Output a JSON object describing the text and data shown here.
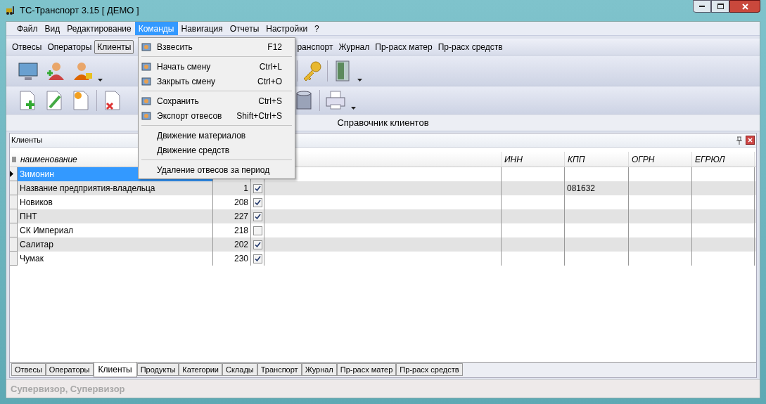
{
  "window": {
    "title": "ТС-Транспорт 3.15 [ ДЕМО ]"
  },
  "menubar": [
    {
      "label": "Файл",
      "selected": false
    },
    {
      "label": "Вид",
      "selected": false
    },
    {
      "label": "Редактирование",
      "selected": false
    },
    {
      "label": "Команды",
      "selected": true
    },
    {
      "label": "Навигация",
      "selected": false
    },
    {
      "label": "Отчеты",
      "selected": false
    },
    {
      "label": "Настройки",
      "selected": false
    },
    {
      "label": "?",
      "selected": false
    }
  ],
  "nav_toolbar": {
    "left": [
      {
        "label": "Отвесы",
        "selected": false
      },
      {
        "label": "Операторы",
        "selected": false
      },
      {
        "label": "Клиенты",
        "selected": true
      }
    ],
    "right": [
      {
        "label": "ранспорт",
        "selected": false
      },
      {
        "label": "Журнал",
        "selected": false
      },
      {
        "label": "Пр-расх матер",
        "selected": false
      },
      {
        "label": "Пр-расх средств",
        "selected": false
      }
    ]
  },
  "dropdown_menu": [
    [
      {
        "label": "Взвесить",
        "shortcut": "F12",
        "icon": true
      }
    ],
    [
      {
        "label": "Начать смену",
        "shortcut": "Ctrl+L",
        "icon": true
      },
      {
        "label": "Закрыть смену",
        "shortcut": "Ctrl+O",
        "icon": true
      }
    ],
    [
      {
        "label": "Сохранить",
        "shortcut": "Ctrl+S",
        "icon": true
      },
      {
        "label": "Экспорт отвесов",
        "shortcut": "Shift+Ctrl+S",
        "icon": true
      }
    ],
    [
      {
        "label": "Движение материалов",
        "icon": false
      },
      {
        "label": "Движение средств",
        "icon": false
      }
    ],
    [
      {
        "label": "Удаление отвесов за период",
        "icon": false
      }
    ]
  ],
  "section_title": "Справочник клиентов",
  "panel": {
    "title": "Клиенты"
  },
  "table": {
    "columns": [
      {
        "label": "наименование"
      },
      {
        "label": "ИНН"
      },
      {
        "label": "КПП"
      },
      {
        "label": "ОГРН"
      },
      {
        "label": "ЕГРЮЛ"
      }
    ],
    "rows": [
      {
        "name": "Зимонин",
        "selected": true
      },
      {
        "name": "Название предприятия-владельца",
        "number": "1",
        "checked": true,
        "kpp": "081632",
        "selected": false
      },
      {
        "name": "Новиков",
        "number": "208",
        "checked": true,
        "selected": false
      },
      {
        "name": "ПНТ",
        "number": "227",
        "checked": true,
        "selected": false
      },
      {
        "name": "СК Империал",
        "number": "218",
        "checked": false,
        "selected": false
      },
      {
        "name": "Салитар",
        "number": "202",
        "checked": true,
        "selected": false
      },
      {
        "name": "Чумак",
        "number": "230",
        "checked": true,
        "selected": false
      }
    ]
  },
  "bottom_tabs": [
    {
      "label": "Отвесы",
      "selected": false
    },
    {
      "label": "Операторы",
      "selected": false
    },
    {
      "label": "Клиенты",
      "selected": true
    },
    {
      "label": "Продукты",
      "selected": false
    },
    {
      "label": "Категории",
      "selected": false
    },
    {
      "label": "Склады",
      "selected": false
    },
    {
      "label": "Транспорт",
      "selected": false
    },
    {
      "label": "Журнал",
      "selected": false
    },
    {
      "label": "Пр-расх матер",
      "selected": false
    },
    {
      "label": "Пр-расх средств",
      "selected": false
    }
  ],
  "status_bar": "Супервизор, Супервизор"
}
